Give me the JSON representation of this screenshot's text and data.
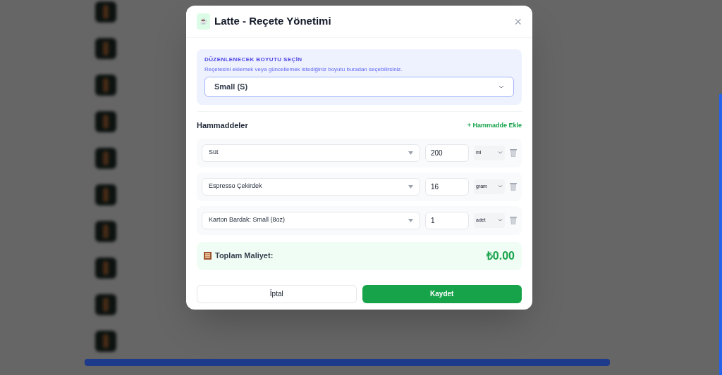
{
  "modal": {
    "icon": "☕",
    "title": "Latte - Reçete Yönetimi",
    "close": "×"
  },
  "size_picker": {
    "heading": "DÜZENLENECEK BOYUTU SEÇİN",
    "hint": "Reçetesini eklemek veya güncellemek istediğiniz boyutu buradan seçebilirsiniz.",
    "value": "Small (S)"
  },
  "ingredients": {
    "heading": "Hammaddeler",
    "add_button": "+ Hammadde Ekle",
    "rows": [
      {
        "material": "Süt",
        "amount": "200",
        "unit": "ml"
      },
      {
        "material": "Espresso Çekirdek",
        "amount": "16",
        "unit": "gram"
      },
      {
        "material": "Karton Bardak: Small (8oz)",
        "amount": "1",
        "unit": "adet"
      }
    ]
  },
  "total": {
    "label": "Toplam Maliyet:",
    "value": "₺0.00"
  },
  "buttons": [
    {
      "kind": "secondary",
      "label": "İptal"
    },
    {
      "kind": "primary",
      "label": "Kaydet"
    }
  ]
}
